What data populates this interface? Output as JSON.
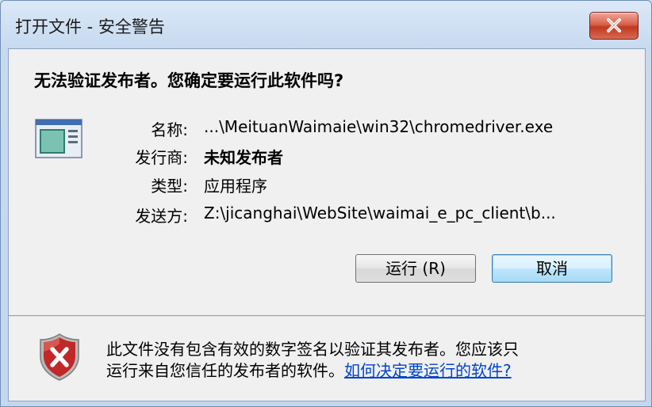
{
  "window": {
    "title": "打开文件 - 安全警告",
    "close_icon": "close-icon"
  },
  "headline": "无法验证发布者。您确定要运行此软件吗?",
  "file_icon": "application-file-icon",
  "fields": [
    {
      "label": "名称:",
      "value": "...\\MeituanWaimaie\\win32\\chromedriver.exe",
      "bold": false
    },
    {
      "label": "发行商:",
      "value": "未知发布者",
      "bold": true
    },
    {
      "label": "类型:",
      "value": "应用程序",
      "bold": false
    },
    {
      "label": "发送方:",
      "value": "Z:\\jicanghai\\WebSite\\waimai_e_pc_client\\b...",
      "bold": false
    }
  ],
  "buttons": {
    "run": "运行 (R)",
    "cancel": "取消"
  },
  "warning": {
    "icon": "shield-error-icon",
    "line1": "此文件没有包含有效的数字签名以验证其发布者。您应该只",
    "line2": "运行来自您信任的发布者的软件。",
    "link": "如何决定要运行的软件?"
  },
  "colors": {
    "close_button": "#c84a33",
    "link": "#0044cc",
    "shield": "#c0282a"
  }
}
